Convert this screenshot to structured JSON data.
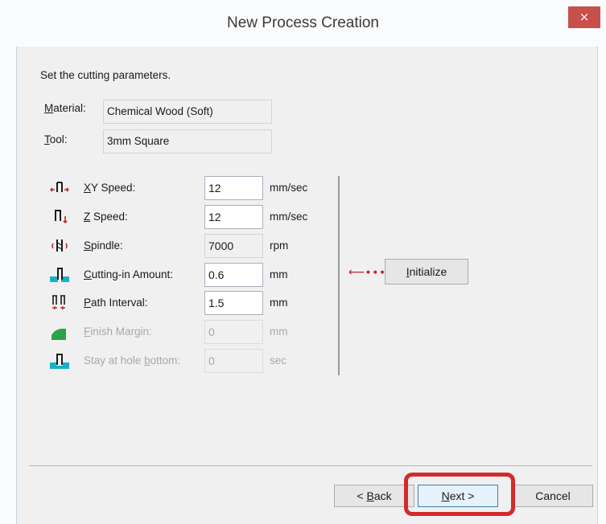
{
  "window": {
    "title": "New Process Creation",
    "close_glyph": "×"
  },
  "instruction": "Set the cutting parameters.",
  "info": {
    "material_label": "Material:",
    "material_value": "Chemical Wood (Soft)",
    "tool_label": "Tool:",
    "tool_value": "3mm Square"
  },
  "params": [
    {
      "label": "XY Speed:",
      "value": "12",
      "unit": "mm/sec",
      "icon": "xy-speed-icon",
      "enabled": true
    },
    {
      "label": "Z Speed:",
      "value": "12",
      "unit": "mm/sec",
      "icon": "z-speed-icon",
      "enabled": true
    },
    {
      "label": "Spindle:",
      "value": "7000",
      "unit": "rpm",
      "icon": "spindle-icon",
      "enabled": true
    },
    {
      "label": "Cutting-in Amount:",
      "value": "0.6",
      "unit": "mm",
      "icon": "cutting-in-icon",
      "enabled": true
    },
    {
      "label": "Path Interval:",
      "value": "1.5",
      "unit": "mm",
      "icon": "path-interval-icon",
      "enabled": true
    },
    {
      "label": "Finish Margin:",
      "value": "0",
      "unit": "mm",
      "icon": "finish-margin-icon",
      "enabled": false
    },
    {
      "label": "Stay at hole bottom:",
      "value": "0",
      "unit": "sec",
      "icon": "hole-bottom-icon",
      "enabled": false
    }
  ],
  "initialize": {
    "arrow": "⟵∙∙∙",
    "label": "Initialize"
  },
  "buttons": {
    "back": "< Back",
    "next": "Next >",
    "cancel": "Cancel"
  },
  "colors": {
    "highlight": "#d42a2a",
    "close_button": "#c8504a",
    "icon_red": "#c0282a",
    "icon_cyan": "#1ab0c8",
    "icon_green": "#2aa34a"
  }
}
